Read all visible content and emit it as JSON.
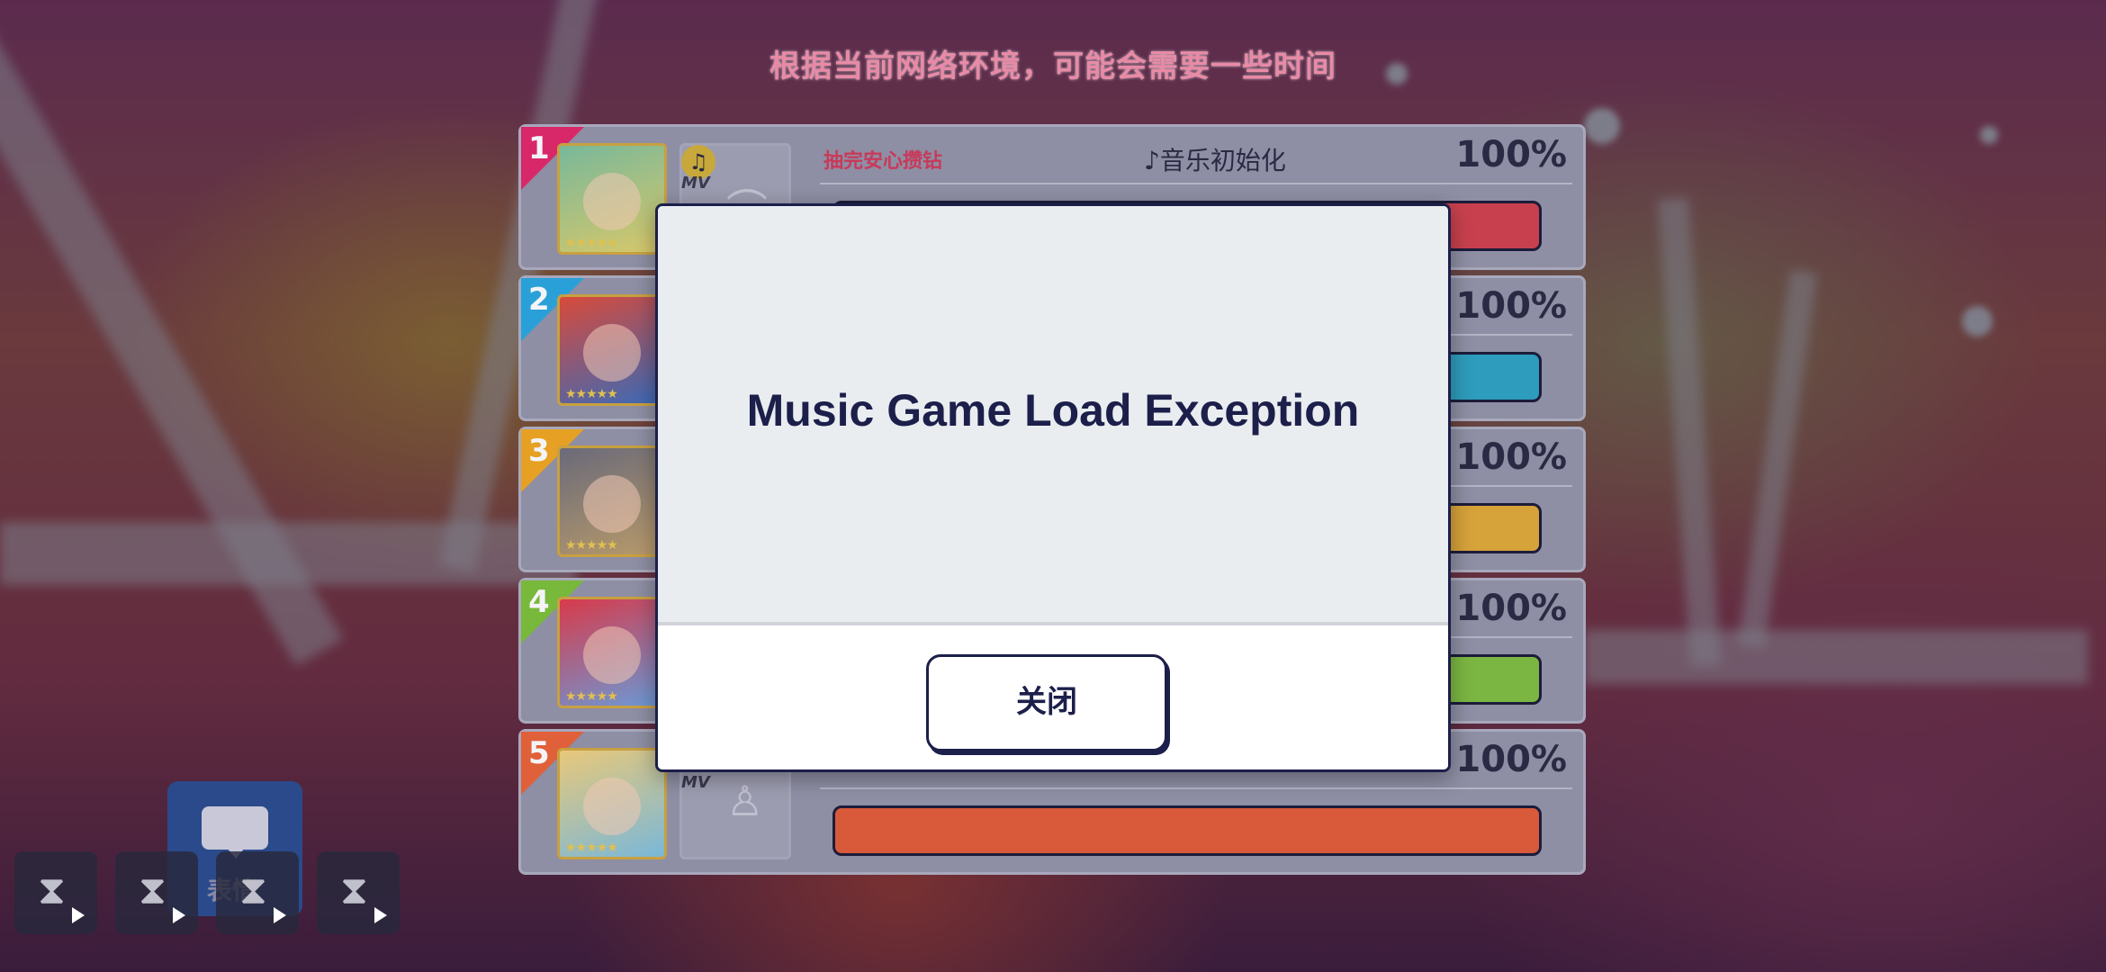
{
  "loading_message": "根据当前网络环境，可能会需要一些时间",
  "members": [
    {
      "rank": "1",
      "progress": "100%",
      "progress_value": 100,
      "bar_color": "#c8404e",
      "corner_color": "#d8286a",
      "card_colors": [
        "#78b89a",
        "#d8c86a"
      ],
      "gacha_label": "抽完安心攒钻",
      "music_label": "♪音乐初始化",
      "mv": "MV",
      "note": "♫"
    },
    {
      "rank": "2",
      "progress": "100%",
      "progress_value": 100,
      "bar_color": "#2e9cbc",
      "corner_color": "#2aa0d8",
      "card_colors": [
        "#d84a3a",
        "#3a6ab8"
      ]
    },
    {
      "rank": "3",
      "progress": "100%",
      "progress_value": 100,
      "bar_color": "#d6a23a",
      "corner_color": "#e6a024",
      "card_colors": [
        "#6a6a7a",
        "#b89a6a"
      ]
    },
    {
      "rank": "4",
      "progress": "100%",
      "progress_value": 100,
      "bar_color": "#7cb642",
      "corner_color": "#78b83a",
      "card_colors": [
        "#d83a4a",
        "#6a9ad8"
      ]
    },
    {
      "rank": "5",
      "progress": "100%",
      "progress_value": 100,
      "bar_color": "#d85a3a",
      "corner_color": "#e0603a",
      "card_colors": [
        "#e8c87a",
        "#7ab8d8"
      ],
      "mv": "MV"
    }
  ],
  "emote_label": "表情",
  "dialog": {
    "title": "Music Game Load Exception",
    "close_label": "关闭"
  },
  "slot_icons": [
    "hourglass-icon",
    "hourglass-icon",
    "hourglass-icon",
    "hourglass-icon"
  ]
}
